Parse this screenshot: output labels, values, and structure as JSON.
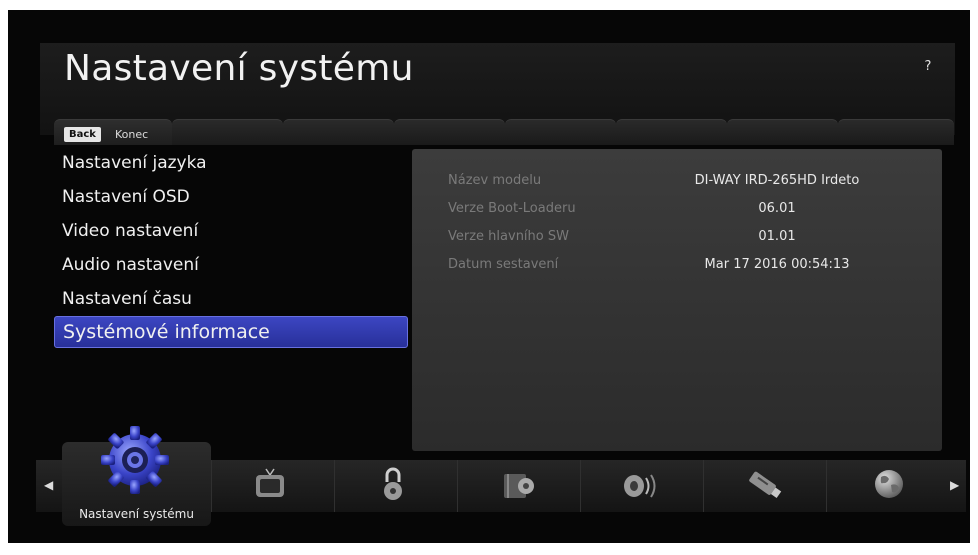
{
  "header": {
    "title": "Nastavení systému",
    "help_label": "?"
  },
  "tabs": {
    "back_label": "Back",
    "exit_label": "Konec"
  },
  "menu": {
    "items": [
      {
        "label": "Nastavení jazyka"
      },
      {
        "label": "Nastavení OSD"
      },
      {
        "label": "Video nastavení"
      },
      {
        "label": "Audio nastavení"
      },
      {
        "label": "Nastavení času"
      },
      {
        "label": "Systémové informace",
        "selected": true
      }
    ]
  },
  "info": {
    "rows": [
      {
        "label": "Název modelu",
        "value": "DI-WAY IRD-265HD Irdeto"
      },
      {
        "label": "Verze Boot-Loaderu",
        "value": "06.01"
      },
      {
        "label": "Verze hlavního SW",
        "value": "01.01"
      },
      {
        "label": "Datum sestavení",
        "value": "Mar 17 2016 00:54:13"
      }
    ]
  },
  "categories": {
    "selected_label": "Nastavení systému",
    "icons": [
      "gear-icon",
      "tv-icon",
      "padlock-icon",
      "media-icon",
      "speaker-icon",
      "usb-icon",
      "globe-icon"
    ]
  },
  "colors": {
    "selection": "#3a44c0",
    "panel": "#333333",
    "background": "#060606"
  }
}
